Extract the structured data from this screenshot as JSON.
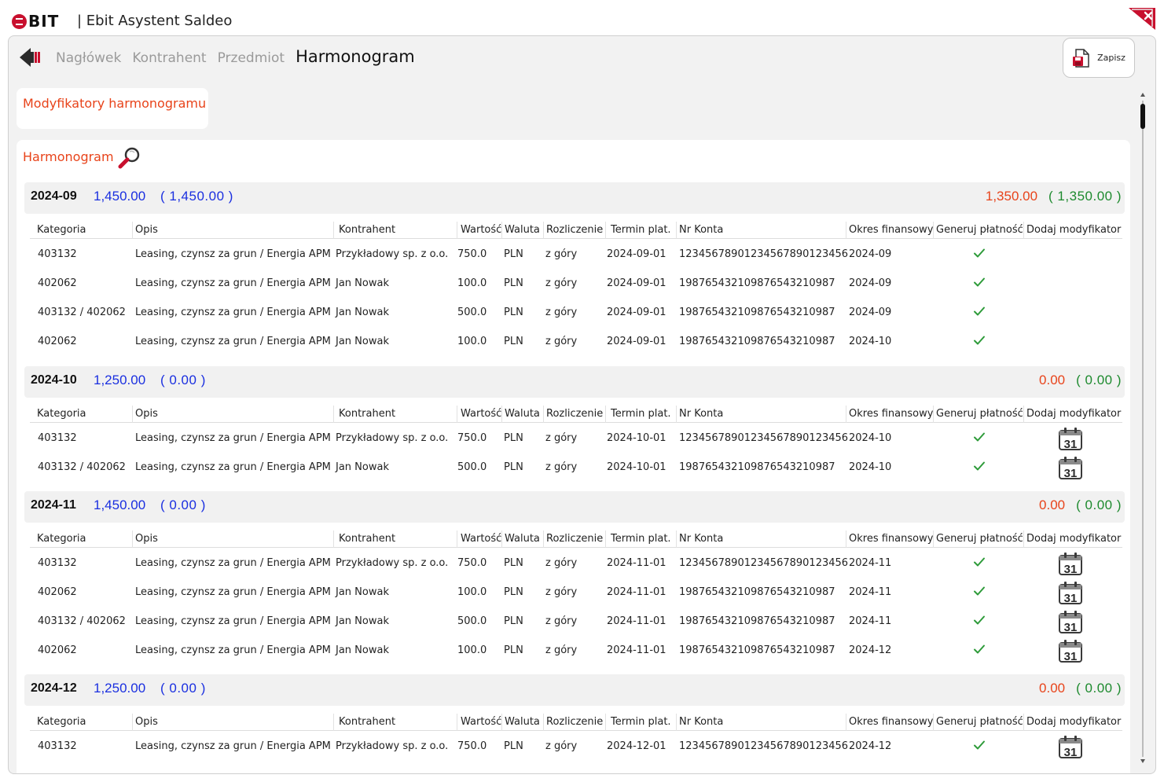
{
  "app": {
    "title": "| Ebit Asystent Saldeo",
    "logo": "EBIT"
  },
  "toolbar": {
    "tabs": [
      "Nagłówek",
      "Kontrahent",
      "Przedmiot",
      "Harmonogram"
    ],
    "save_label": "Zapisz"
  },
  "modifiers": {
    "title": "Modyfikatory harmonogramu"
  },
  "schedule": {
    "title": "Harmonogram",
    "columns": [
      "Kategoria",
      "Opis",
      "Kontrahent",
      "Wartość",
      "Waluta",
      "Rozliczenie",
      "Termin plat.",
      "Nr Konta",
      "Okres finansowy",
      "Generuj płatność",
      "Dodaj modyfikator"
    ],
    "groups": [
      {
        "month": "2024-09",
        "sum": "1,450.00",
        "sum_paren": "( 1,450.00 )",
        "right_sum": "1,350.00",
        "right_paren": "( 1,350.00 )",
        "rows": [
          {
            "kategoria": "403132",
            "opis": "Leasing, czynsz za grun / Energia APM",
            "kontrahent": "Przykładowy sp. z o.o.",
            "wartosc": "750.0",
            "waluta": "PLN",
            "rozliczenie": "z góry",
            "termin": "2024-09-01",
            "konto": "12345678901234567890123456",
            "okres": "2024-09",
            "generuj": true,
            "modyfikator": false
          },
          {
            "kategoria": "402062",
            "opis": "Leasing, czynsz za grun / Energia APM",
            "kontrahent": "Jan Nowak",
            "wartosc": "100.0",
            "waluta": "PLN",
            "rozliczenie": "z góry",
            "termin": "2024-09-01",
            "konto": "19876543210987654321​0987",
            "okres": "2024-09",
            "generuj": true,
            "modyfikator": false
          },
          {
            "kategoria": "403132 / 402062",
            "opis": "Leasing, czynsz za grun / Energia APM",
            "kontrahent": "Jan Nowak",
            "wartosc": "500.0",
            "waluta": "PLN",
            "rozliczenie": "z góry",
            "termin": "2024-09-01",
            "konto": "19876543210987654321​0987",
            "okres": "2024-09",
            "generuj": true,
            "modyfikator": false
          },
          {
            "kategoria": "402062",
            "opis": "Leasing, czynsz za grun / Energia APM",
            "kontrahent": "Jan Nowak",
            "wartosc": "100.0",
            "waluta": "PLN",
            "rozliczenie": "z góry",
            "termin": "2024-09-01",
            "konto": "19876543210987654321​0987",
            "okres": "2024-10",
            "generuj": true,
            "modyfikator": false
          }
        ]
      },
      {
        "month": "2024-10",
        "sum": "1,250.00",
        "sum_paren": "( 0.00 )",
        "right_sum": "0.00",
        "right_paren": "( 0.00 )",
        "rows": [
          {
            "kategoria": "403132",
            "opis": "Leasing, czynsz za grun / Energia APM",
            "kontrahent": "Przykładowy sp. z o.o.",
            "wartosc": "750.0",
            "waluta": "PLN",
            "rozliczenie": "z góry",
            "termin": "2024-10-01",
            "konto": "12345678901234567890123456",
            "okres": "2024-10",
            "generuj": true,
            "modyfikator": true
          },
          {
            "kategoria": "403132 / 402062",
            "opis": "Leasing, czynsz za grun / Energia APM",
            "kontrahent": "Jan Nowak",
            "wartosc": "500.0",
            "waluta": "PLN",
            "rozliczenie": "z góry",
            "termin": "2024-10-01",
            "konto": "19876543210987654321​0987",
            "okres": "2024-10",
            "generuj": true,
            "modyfikator": true
          }
        ]
      },
      {
        "month": "2024-11",
        "sum": "1,450.00",
        "sum_paren": "( 0.00 )",
        "right_sum": "0.00",
        "right_paren": "( 0.00 )",
        "rows": [
          {
            "kategoria": "403132",
            "opis": "Leasing, czynsz za grun / Energia APM",
            "kontrahent": "Przykładowy sp. z o.o.",
            "wartosc": "750.0",
            "waluta": "PLN",
            "rozliczenie": "z góry",
            "termin": "2024-11-01",
            "konto": "12345678901234567890123456",
            "okres": "2024-11",
            "generuj": true,
            "modyfikator": true
          },
          {
            "kategoria": "402062",
            "opis": "Leasing, czynsz za grun / Energia APM",
            "kontrahent": "Jan Nowak",
            "wartosc": "100.0",
            "waluta": "PLN",
            "rozliczenie": "z góry",
            "termin": "2024-11-01",
            "konto": "19876543210987654321​0987",
            "okres": "2024-11",
            "generuj": true,
            "modyfikator": true
          },
          {
            "kategoria": "403132 / 402062",
            "opis": "Leasing, czynsz za grun / Energia APM",
            "kontrahent": "Jan Nowak",
            "wartosc": "500.0",
            "waluta": "PLN",
            "rozliczenie": "z góry",
            "termin": "2024-11-01",
            "konto": "19876543210987654321​0987",
            "okres": "2024-11",
            "generuj": true,
            "modyfikator": true
          },
          {
            "kategoria": "402062",
            "opis": "Leasing, czynsz za grun / Energia APM",
            "kontrahent": "Jan Nowak",
            "wartosc": "100.0",
            "waluta": "PLN",
            "rozliczenie": "z góry",
            "termin": "2024-11-01",
            "konto": "19876543210987654321​0987",
            "okres": "2024-12",
            "generuj": true,
            "modyfikator": true
          }
        ]
      },
      {
        "month": "2024-12",
        "sum": "1,250.00",
        "sum_paren": "( 0.00 )",
        "right_sum": "0.00",
        "right_paren": "( 0.00 )",
        "rows": [
          {
            "kategoria": "403132",
            "opis": "Leasing, czynsz za grun / Energia APM",
            "kontrahent": "Przykładowy sp. z o.o.",
            "wartosc": "750.0",
            "waluta": "PLN",
            "rozliczenie": "z góry",
            "termin": "2024-12-01",
            "konto": "12345678901234567890123456",
            "okres": "2024-12",
            "generuj": true,
            "modyfikator": true
          }
        ]
      }
    ]
  },
  "icons": {
    "back": "back-arrow-icon",
    "save": "save-document-icon",
    "search": "magnifier-icon",
    "check": "checkmark-icon",
    "calendar": "calendar-31-icon",
    "close": "close-icon"
  },
  "colors": {
    "accent": "#e8431a",
    "blue_sum": "#1a2fe0",
    "green_sum": "#1d8a2e",
    "check": "#2e9b3a"
  },
  "calendar_day": "31"
}
